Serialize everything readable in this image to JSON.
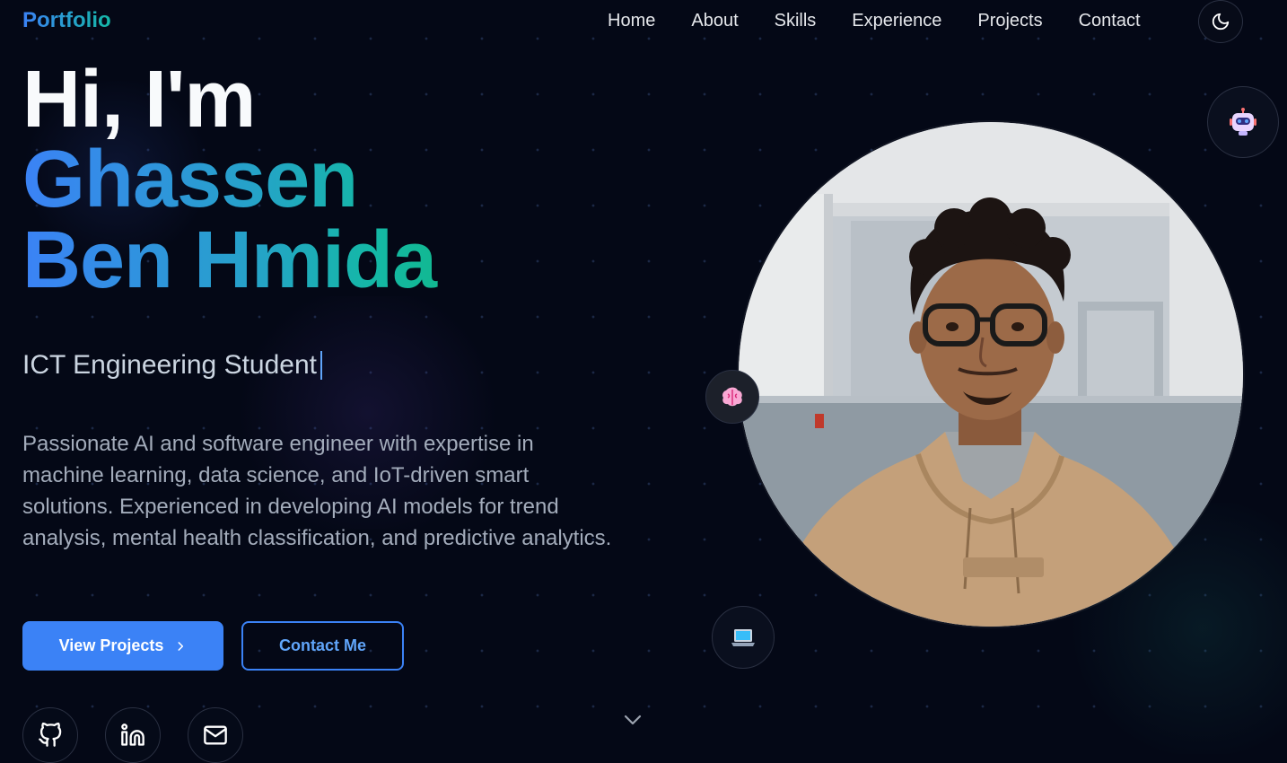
{
  "nav": {
    "logo": "Portfolio",
    "links": [
      "Home",
      "About",
      "Skills",
      "Experience",
      "Projects",
      "Contact"
    ]
  },
  "hero": {
    "greeting": "Hi, I'm",
    "name_line1": "Ghassen",
    "name_line2": "Ben Hmida",
    "role": "ICT Engineering Student",
    "description": "Passionate AI and software engineer with expertise in machine learning, data science, and IoT-driven smart solutions. Experienced in developing AI models for trend analysis, mental health classification, and predictive analytics.",
    "primary_button": "View Projects",
    "secondary_button": "Contact Me"
  },
  "social_icons": [
    "github-icon",
    "linkedin-icon",
    "mail-icon"
  ],
  "floating_icons": [
    "robot-icon",
    "brain-icon",
    "laptop-icon"
  ],
  "colors": {
    "background": "#040816",
    "accent_blue": "#3b82f6",
    "accent_teal": "#14b8a6",
    "text_muted": "#a3acbb"
  }
}
